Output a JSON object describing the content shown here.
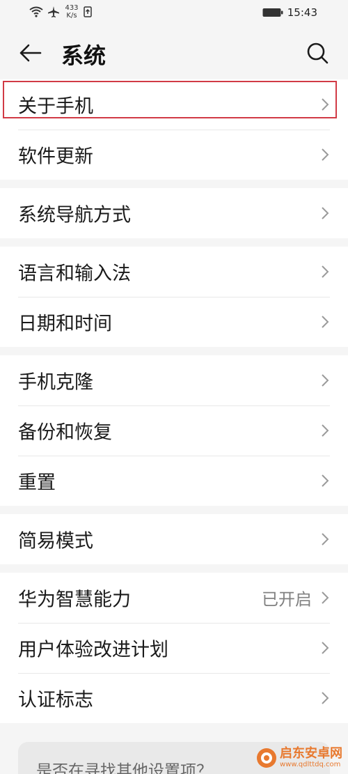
{
  "status": {
    "net_speed_value": "433",
    "net_speed_unit": "K/s",
    "time": "15:43"
  },
  "header": {
    "title": "系统"
  },
  "groups": [
    {
      "items": [
        {
          "label": "关于手机"
        },
        {
          "label": "软件更新"
        }
      ]
    },
    {
      "items": [
        {
          "label": "系统导航方式"
        }
      ]
    },
    {
      "items": [
        {
          "label": "语言和输入法"
        },
        {
          "label": "日期和时间"
        }
      ]
    },
    {
      "items": [
        {
          "label": "手机克隆"
        },
        {
          "label": "备份和恢复"
        },
        {
          "label": "重置"
        }
      ]
    },
    {
      "items": [
        {
          "label": "简易模式"
        }
      ]
    },
    {
      "items": [
        {
          "label": "华为智慧能力",
          "value": "已开启"
        },
        {
          "label": "用户体验改进计划"
        },
        {
          "label": "认证标志"
        }
      ]
    }
  ],
  "suggest": {
    "text": "是否在寻找其他设置项？"
  },
  "watermark": {
    "name": "启东安卓网",
    "url": "www.qdlttdq.com"
  },
  "colors": {
    "highlight_border": "#d13a45",
    "background": "#f5f5f5",
    "watermark": "#e8792f"
  },
  "icons": [
    "wifi-icon",
    "airplane-icon",
    "upload-icon",
    "battery-icon",
    "back-arrow-icon",
    "search-icon",
    "chevron-right-icon"
  ]
}
